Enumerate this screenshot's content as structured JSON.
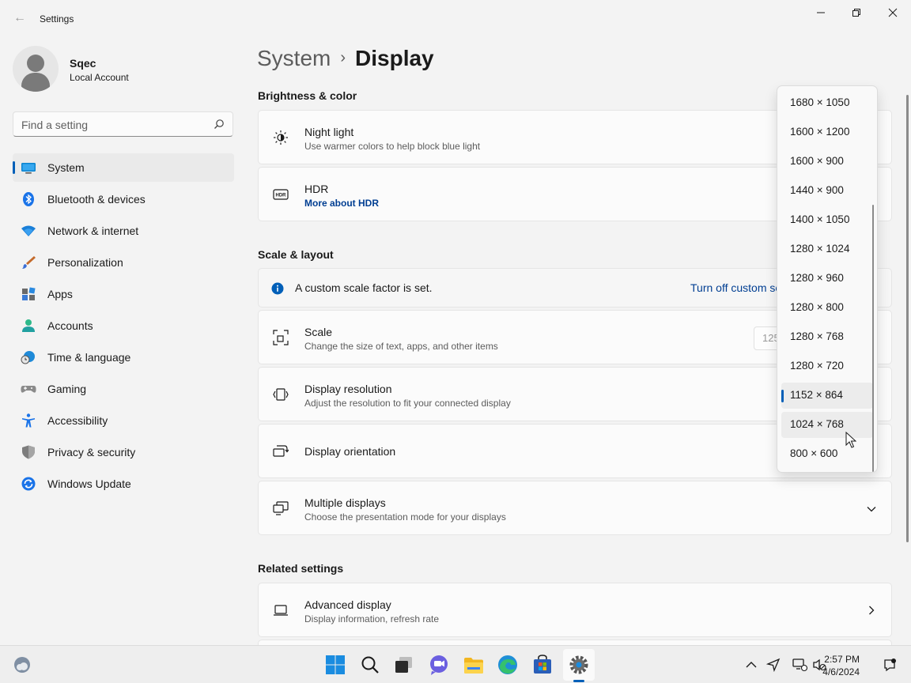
{
  "window": {
    "title": "Settings",
    "controls": [
      "minimize",
      "restore",
      "close"
    ]
  },
  "profile": {
    "name": "Sqec",
    "account_type": "Local Account"
  },
  "search": {
    "placeholder": "Find a setting"
  },
  "nav": {
    "items": [
      {
        "label": "System",
        "icon": "monitor-icon",
        "active": true
      },
      {
        "label": "Bluetooth & devices",
        "icon": "bluetooth-icon"
      },
      {
        "label": "Network & internet",
        "icon": "wifi-icon"
      },
      {
        "label": "Personalization",
        "icon": "brush-icon"
      },
      {
        "label": "Apps",
        "icon": "apps-icon"
      },
      {
        "label": "Accounts",
        "icon": "person-icon"
      },
      {
        "label": "Time & language",
        "icon": "globe-clock-icon"
      },
      {
        "label": "Gaming",
        "icon": "gamepad-icon"
      },
      {
        "label": "Accessibility",
        "icon": "accessibility-icon"
      },
      {
        "label": "Privacy & security",
        "icon": "shield-icon"
      },
      {
        "label": "Windows Update",
        "icon": "update-icon"
      }
    ]
  },
  "breadcrumb": {
    "parent": "System",
    "separator": "›",
    "current": "Display"
  },
  "sections": {
    "brightness": "Brightness & color",
    "scale_layout": "Scale & layout",
    "related": "Related settings"
  },
  "cards": {
    "night_light": {
      "title": "Night light",
      "subtitle": "Use warmer colors to help block blue light"
    },
    "hdr": {
      "title": "HDR",
      "link": "More about HDR"
    },
    "custom_scale": {
      "text": "A custom scale factor is set.",
      "link": "Turn off custom scaling and sign out"
    },
    "scale": {
      "title": "Scale",
      "subtitle": "Change the size of text, apps, and other items",
      "value": "125%"
    },
    "resolution": {
      "title": "Display resolution",
      "subtitle": "Adjust the resolution to fit your connected display"
    },
    "orientation": {
      "title": "Display orientation"
    },
    "multiple": {
      "title": "Multiple displays",
      "subtitle": "Choose the presentation mode for your displays"
    },
    "advanced": {
      "title": "Advanced display",
      "subtitle": "Display information, refresh rate"
    }
  },
  "resolution_dropdown": {
    "options": [
      "1680 × 1050",
      "1600 × 1200",
      "1600 × 900",
      "1440 × 900",
      "1400 × 1050",
      "1280 × 1024",
      "1280 × 960",
      "1280 × 800",
      "1280 × 768",
      "1280 × 720",
      "1152 × 864",
      "1024 × 768",
      "800 × 600"
    ],
    "selected": "1152 × 864",
    "hovered": "1024 × 768"
  },
  "taskbar": {
    "apps": [
      "start-icon",
      "search-icon",
      "task-view-icon",
      "chat-icon",
      "file-explorer-icon",
      "edge-icon",
      "store-icon",
      "settings-icon"
    ],
    "time": "2:57 PM",
    "date": "4/6/2024"
  },
  "colors": {
    "accent": "#005fb8",
    "link": "#003e92",
    "background": "#f3f3f3",
    "card": "#fbfbfb"
  }
}
